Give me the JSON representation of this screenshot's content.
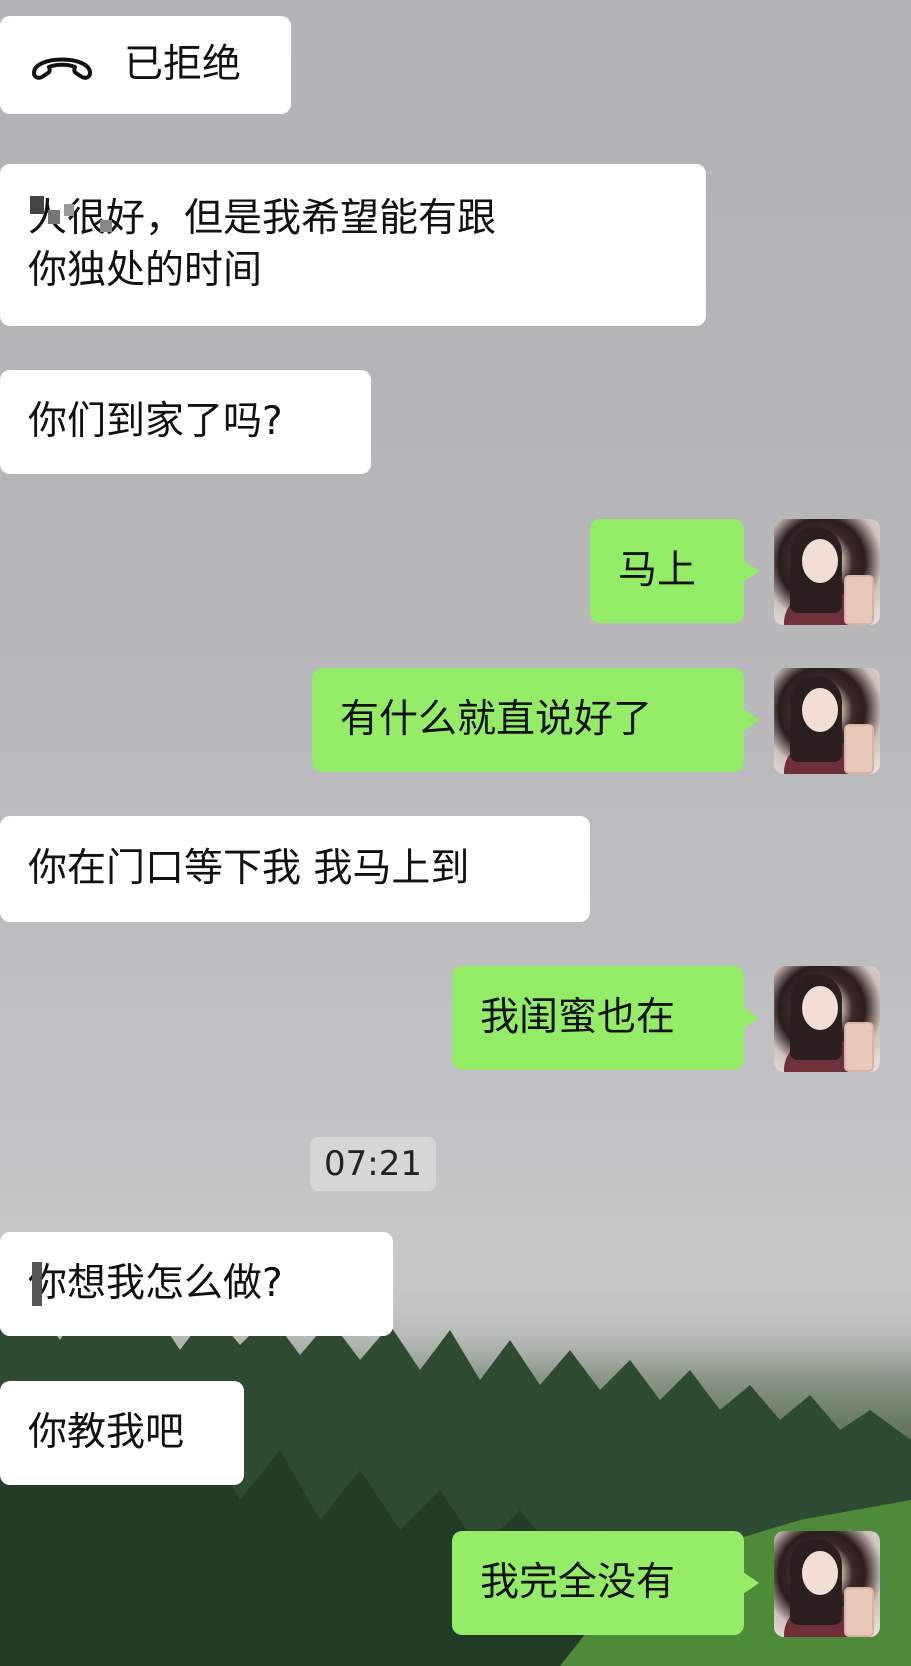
{
  "messages": {
    "m1": {
      "text": "已拒绝",
      "icon": "phone-hangup-icon"
    },
    "m2": {
      "text": "人很好，但是我希望能有跟\n你独处的时间"
    },
    "m3": {
      "text": "你们到家了吗?"
    },
    "m4": {
      "text": "马上"
    },
    "m5": {
      "text": "有什么就直说好了"
    },
    "m6": {
      "text": "你在门口等下我 我马上到"
    },
    "m7": {
      "text": "我闺蜜也在"
    },
    "m8": {
      "text": "你想我怎么做?"
    },
    "m9": {
      "text": "你教我吧"
    },
    "m10": {
      "text": "我完全没有"
    }
  },
  "timestamp": "07:21",
  "colors": {
    "incoming_bubble": "#ffffff",
    "outgoing_bubble": "#95ec69",
    "timestamp_bg": "#d7d7d7"
  }
}
